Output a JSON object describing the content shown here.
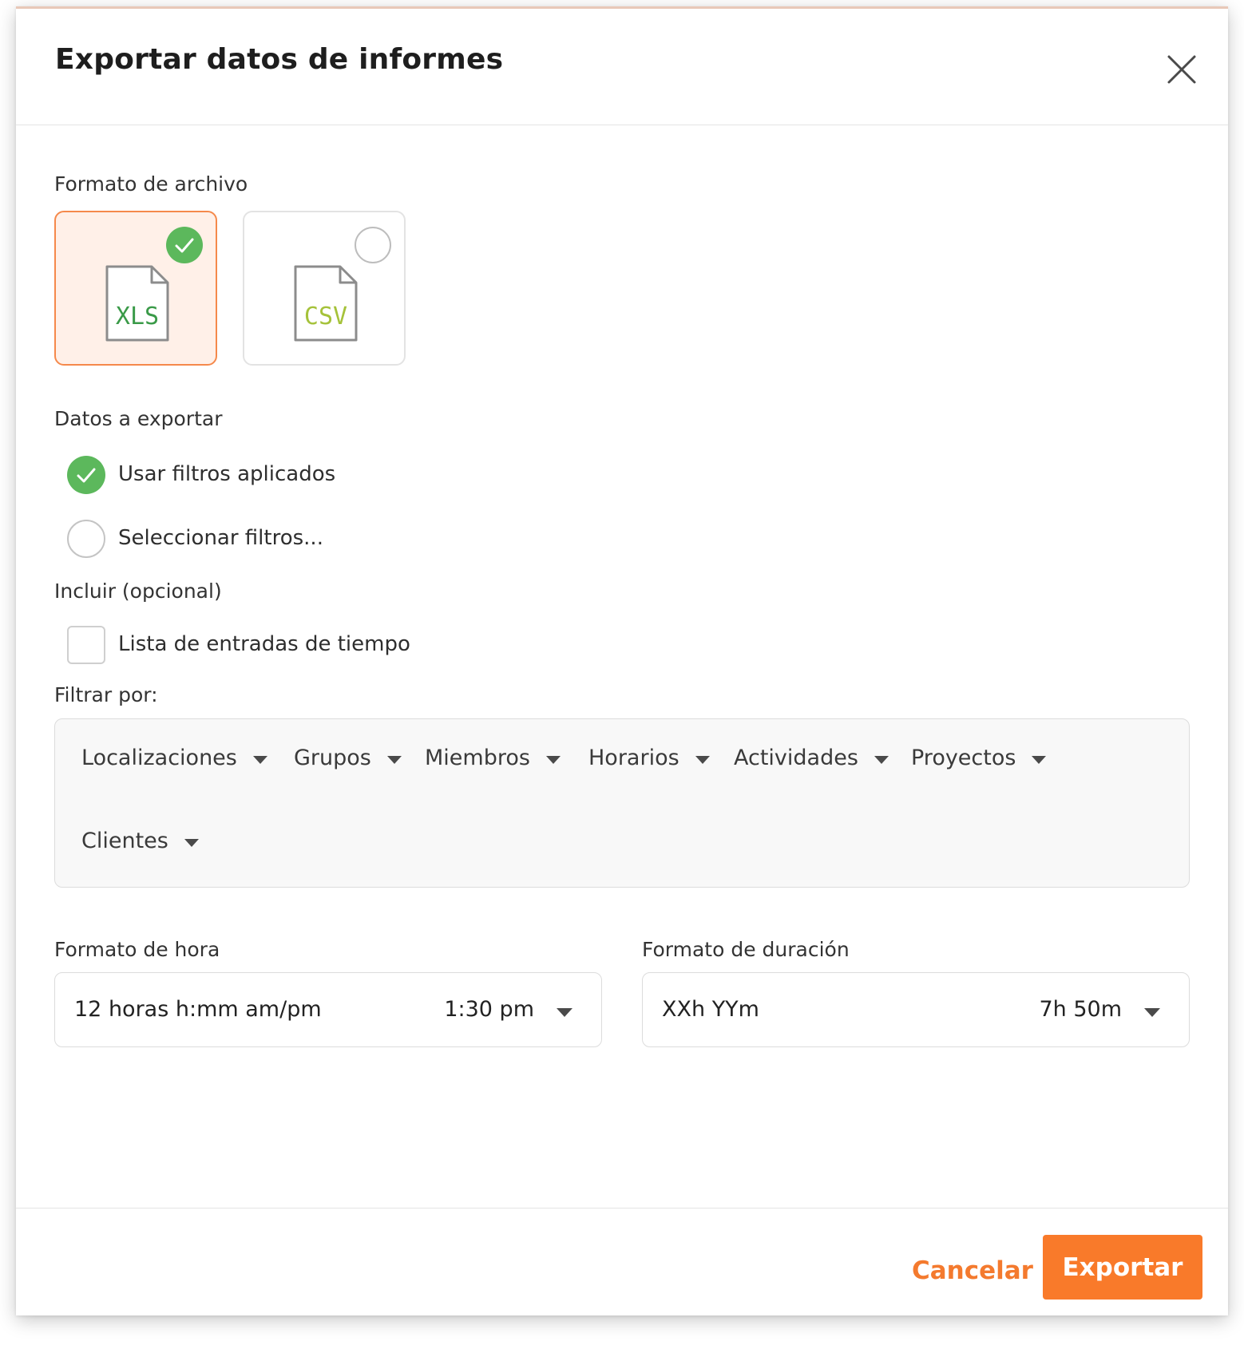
{
  "dialog": {
    "title": "Exportar datos de informes"
  },
  "file_format": {
    "label": "Formato de archivo",
    "options": [
      {
        "text": "XLS",
        "selected": true,
        "color": "#3a9a48"
      },
      {
        "text": "CSV",
        "selected": false,
        "color": "#a5c23a"
      }
    ]
  },
  "data_to_export": {
    "label": "Datos a exportar",
    "options": [
      {
        "label": "Usar filtros aplicados",
        "selected": true
      },
      {
        "label": "Seleccionar filtros...",
        "selected": false
      }
    ]
  },
  "include": {
    "label": "Incluir (opcional)",
    "checkbox_label": "Lista de entradas de tiempo",
    "checked": false
  },
  "filter_by": {
    "label": "Filtrar por:",
    "items": [
      "Localizaciones",
      "Grupos",
      "Miembros",
      "Horarios",
      "Actividades",
      "Proyectos",
      "Clientes"
    ]
  },
  "time_format": {
    "label": "Formato de hora",
    "value": "12 horas h:mm am/pm",
    "example": "1:30 pm"
  },
  "duration_format": {
    "label": "Formato de duración",
    "value": "XXh YYm",
    "example": "7h 50m"
  },
  "footer": {
    "cancel_label": "Cancelar",
    "export_label": "Exportar"
  },
  "colors": {
    "accent": "#f97a2a",
    "success": "#5cb85c",
    "selected_card_bg": "#fff0e8"
  }
}
